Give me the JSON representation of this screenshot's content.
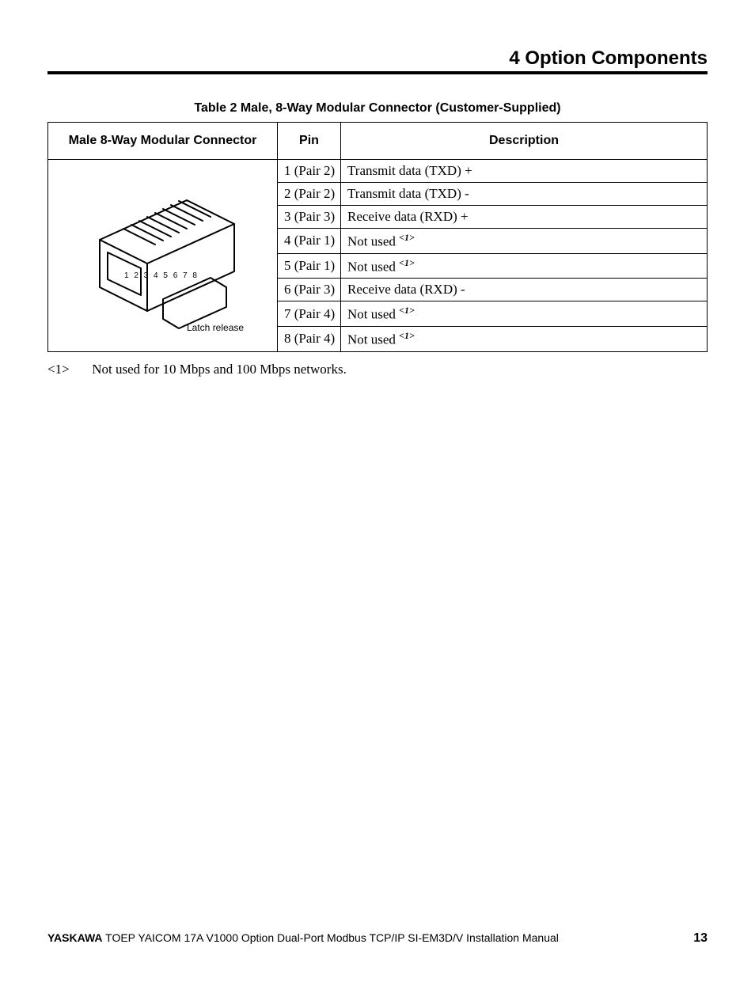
{
  "header": {
    "title": "4  Option Components"
  },
  "table": {
    "caption": "Table 2   Male, 8-Way Modular Connector (Customer-Supplied)",
    "headers": {
      "col1": "Male 8-Way Modular Connector",
      "col2": "Pin",
      "col3": "Description"
    },
    "connector": {
      "pins_label": "1 2 3 4 5 6 7 8",
      "latch_label": "Latch release"
    },
    "rows": [
      {
        "pin": "1 (Pair 2)",
        "desc": "Transmit data (TXD) +",
        "note": false
      },
      {
        "pin": "2 (Pair 2)",
        "desc": "Transmit data (TXD) -",
        "note": false
      },
      {
        "pin": "3 (Pair 3)",
        "desc": "Receive data (RXD) +",
        "note": false
      },
      {
        "pin": "4 (Pair 1)",
        "desc": "Not used ",
        "note": true
      },
      {
        "pin": "5 (Pair 1)",
        "desc": "Not used ",
        "note": true
      },
      {
        "pin": "6 (Pair 3)",
        "desc": "Receive data (RXD) -",
        "note": false
      },
      {
        "pin": "7 (Pair 4)",
        "desc": "Not used ",
        "note": true
      },
      {
        "pin": "8 (Pair 4)",
        "desc": "Not used ",
        "note": true
      }
    ],
    "note_marker": "<1>"
  },
  "footnote": {
    "tag": "<1>",
    "text": "Not used for 10 Mbps and 100 Mbps networks."
  },
  "footer": {
    "brand": "YASKAWA",
    "doc": " TOEP YAICOM 17A V1000 Option Dual-Port Modbus TCP/IP SI-EM3D/V Installation Manual",
    "page": "13"
  },
  "chart_data": {
    "type": "table",
    "title": "Male, 8-Way Modular Connector (Customer-Supplied)",
    "columns": [
      "Pin",
      "Pair",
      "Description"
    ],
    "rows": [
      [
        1,
        2,
        "Transmit data (TXD) +"
      ],
      [
        2,
        2,
        "Transmit data (TXD) -"
      ],
      [
        3,
        3,
        "Receive data (RXD) +"
      ],
      [
        4,
        1,
        "Not used"
      ],
      [
        5,
        1,
        "Not used"
      ],
      [
        6,
        3,
        "Receive data (RXD) -"
      ],
      [
        7,
        4,
        "Not used"
      ],
      [
        8,
        4,
        "Not used"
      ]
    ],
    "notes": {
      "<1>": "Not used for 10 Mbps and 100 Mbps networks."
    }
  }
}
